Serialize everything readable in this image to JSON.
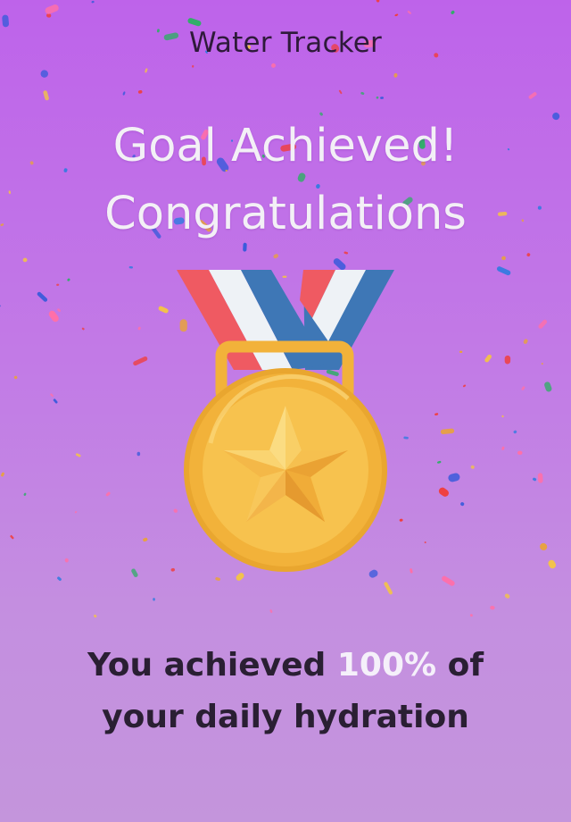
{
  "header": {
    "title": "Water Tracker"
  },
  "celebration": {
    "headline_line1": "Goal Achieved!",
    "headline_line2": "Congratulations"
  },
  "summary": {
    "prefix": "You achieved",
    "percent": "100%",
    "suffix_line1": "of",
    "line2": "your daily hydration",
    "progress_fraction": 1.0
  },
  "icons": {
    "medal": "gold-star-medal-icon",
    "confetti": "confetti-decoration"
  },
  "colors": {
    "background_top": "#be63ea",
    "background_bottom": "#c495dc",
    "medal_gold": "#f7bf4a",
    "ribbon_red": "#ef5a62",
    "ribbon_white": "#eef2f6",
    "ribbon_blue": "#3e77b6"
  }
}
